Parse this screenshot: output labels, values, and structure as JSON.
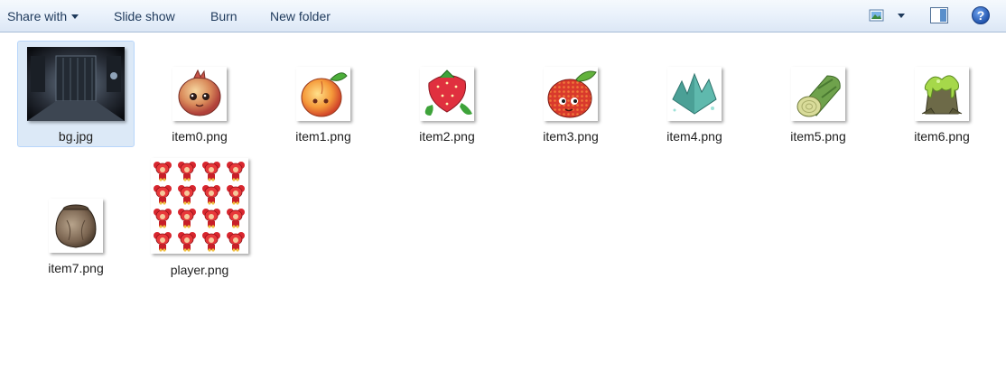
{
  "toolbar": {
    "share_label": "Share with",
    "slideshow_label": "Slide show",
    "burn_label": "Burn",
    "new_folder_label": "New folder",
    "view_icon": "view-options-icon",
    "preview_icon": "preview-pane-icon",
    "help_icon": "help-icon",
    "help_glyph": "?"
  },
  "files": [
    {
      "name": "bg.jpg",
      "thumb": "dark-room-scene",
      "selected": true
    },
    {
      "name": "item0.png",
      "thumb": "pomegranate"
    },
    {
      "name": "item1.png",
      "thumb": "peach"
    },
    {
      "name": "item2.png",
      "thumb": "strawberry"
    },
    {
      "name": "item3.png",
      "thumb": "lychee"
    },
    {
      "name": "item4.png",
      "thumb": "crystal"
    },
    {
      "name": "item5.png",
      "thumb": "log"
    },
    {
      "name": "item6.png",
      "thumb": "slime-stump"
    },
    {
      "name": "item7.png",
      "thumb": "clay-pot"
    },
    {
      "name": "player.png",
      "thumb": "sprite-sheet"
    }
  ],
  "colors": {
    "toolbar_text": "#1e395b",
    "selection_bg": "#dce9f7",
    "selection_border": "#b8d6fb",
    "help_blue": "#2a62c2"
  }
}
